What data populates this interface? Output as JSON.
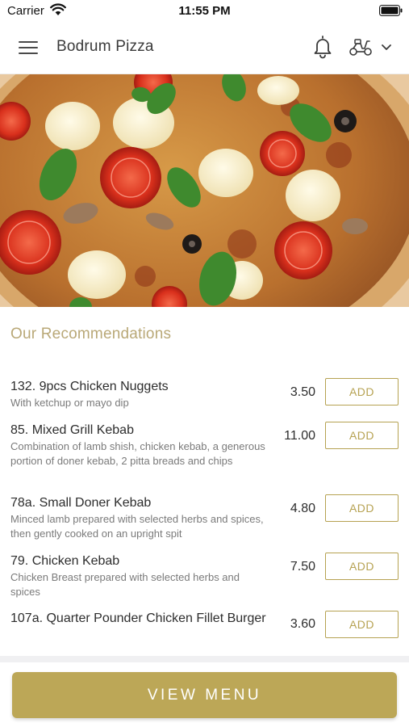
{
  "status_bar": {
    "carrier": "Carrier",
    "time": "11:55 PM"
  },
  "header": {
    "title": "Bodrum Pizza",
    "icons": [
      "menu-icon",
      "bell-icon",
      "scooter-icon",
      "chevron-down-icon"
    ]
  },
  "hero": {
    "image": "pizza-photo"
  },
  "recommendations": {
    "title": "Our Recommendations",
    "items": [
      {
        "name": "132. 9pcs Chicken Nuggets",
        "description": "With ketchup or mayo dip",
        "price": "3.50",
        "action": "ADD"
      },
      {
        "name": "85. Mixed Grill Kebab",
        "description": "Combination of lamb shish, chicken kebab, a generous portion of doner kebab, 2 pitta breads and chips",
        "price": "11.00",
        "action": "ADD"
      },
      {
        "name": "78a. Small Doner Kebab",
        "description": "Minced lamb prepared with selected herbs and spices, then gently cooked on an upright spit",
        "price": "4.80",
        "action": "ADD"
      },
      {
        "name": "79. Chicken Kebab",
        "description": "Chicken Breast prepared with selected herbs and spices",
        "price": "7.50",
        "action": "ADD"
      },
      {
        "name": "107a. Quarter Pounder Chicken Fillet Burger",
        "description": "",
        "price": "3.60",
        "action": "ADD"
      }
    ]
  },
  "footer": {
    "button_label": "VIEW MENU"
  },
  "colors": {
    "accent_gold": "#bca757",
    "section_title": "#b9a877",
    "text_dark": "#2d2d2d",
    "text_muted": "#7a7a7a"
  }
}
